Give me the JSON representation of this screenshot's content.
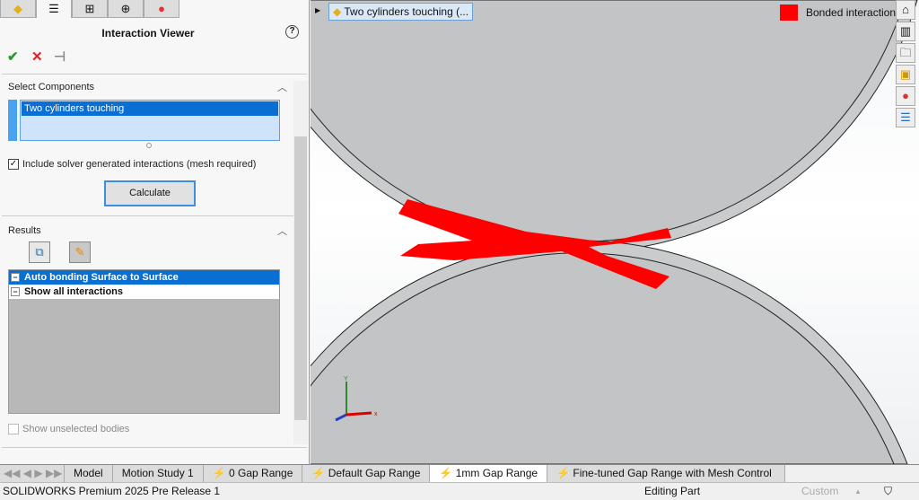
{
  "panel": {
    "title": "Interaction Viewer",
    "help": "?",
    "ok": "✔",
    "cancel": "✕",
    "pin": "⊣",
    "select_section": "Select Components",
    "selected_item": "Two cylinders touching",
    "include_label": "Include solver generated interactions (mesh required)",
    "include_checked": true,
    "calculate": "Calculate",
    "results_section": "Results",
    "results": [
      "Auto bonding Surface to Surface",
      "Show all interactions"
    ],
    "show_unselected": "Show unselected bodies"
  },
  "viewport": {
    "breadcrumb": "Two cylinders touching (...",
    "legend": "Bonded interaction",
    "legend_color": "#ff0000",
    "axis_x": "x",
    "axis_y": "Y"
  },
  "tabs": [
    "Model",
    "Motion Study 1",
    "0 Gap Range",
    "Default Gap Range",
    "1mm Gap Range",
    "Fine-tuned Gap Range with Mesh Control"
  ],
  "active_tab": "1mm Gap Range",
  "status": {
    "app": "SOLIDWORKS Premium 2025 Pre Release 1",
    "mode": "Editing Part",
    "units": "Custom"
  }
}
